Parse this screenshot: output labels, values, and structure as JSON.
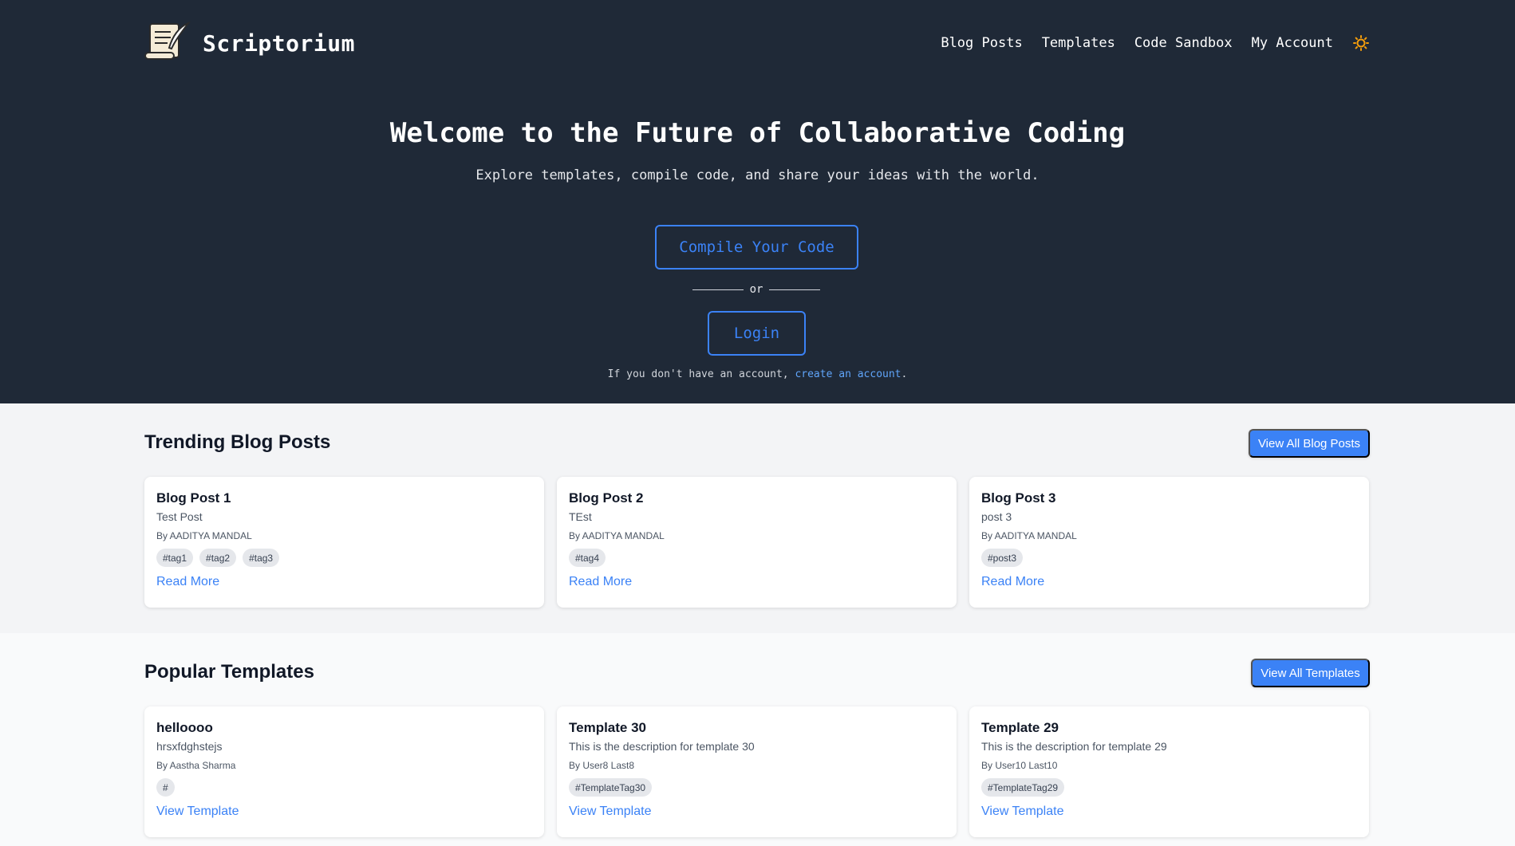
{
  "nav": {
    "brand": "Scriptorium",
    "brand_icon": "scroll-quill-icon",
    "links": [
      "Blog Posts",
      "Templates",
      "Code Sandbox",
      "My Account"
    ],
    "theme_icon": "sun-icon",
    "theme_color": "#f59e0b"
  },
  "hero": {
    "title": "Welcome to the Future of Collaborative Coding",
    "subtitle": "Explore templates, compile code, and share your ideas with the world.",
    "compile_label": "Compile Your Code",
    "divider_text": "or",
    "login_label": "Login",
    "signup_prefix": "If you don't have an account, ",
    "signup_link": "create an account",
    "signup_suffix": "."
  },
  "trending": {
    "title": "Trending Blog Posts",
    "view_all_label": "View All Blog Posts",
    "posts": [
      {
        "title": "Blog Post 1",
        "desc": "Test Post",
        "author": "By AADITYA MANDAL",
        "tags": [
          "#tag1",
          "#tag2",
          "#tag3"
        ],
        "link": "Read More"
      },
      {
        "title": "Blog Post 2",
        "desc": "TEst",
        "author": "By AADITYA MANDAL",
        "tags": [
          "#tag4"
        ],
        "link": "Read More"
      },
      {
        "title": "Blog Post 3",
        "desc": "post 3",
        "author": "By AADITYA MANDAL",
        "tags": [
          "#post3"
        ],
        "link": "Read More"
      }
    ]
  },
  "templates": {
    "title": "Popular Templates",
    "view_all_label": "View All Templates",
    "items": [
      {
        "title": "helloooo",
        "desc": "hrsxfdghstejs",
        "author": "By Aastha Sharma",
        "tags": [
          "#"
        ],
        "link": "View Template"
      },
      {
        "title": "Template 30",
        "desc": "This is the description for template 30",
        "author": "By User8 Last8",
        "tags": [
          "#TemplateTag30"
        ],
        "link": "View Template"
      },
      {
        "title": "Template 29",
        "desc": "This is the description for template 29",
        "author": "By User10 Last10",
        "tags": [
          "#TemplateTag29"
        ],
        "link": "View Template"
      }
    ]
  },
  "colors": {
    "hero_bg": "#1f2937",
    "accent": "#3b82f6"
  }
}
